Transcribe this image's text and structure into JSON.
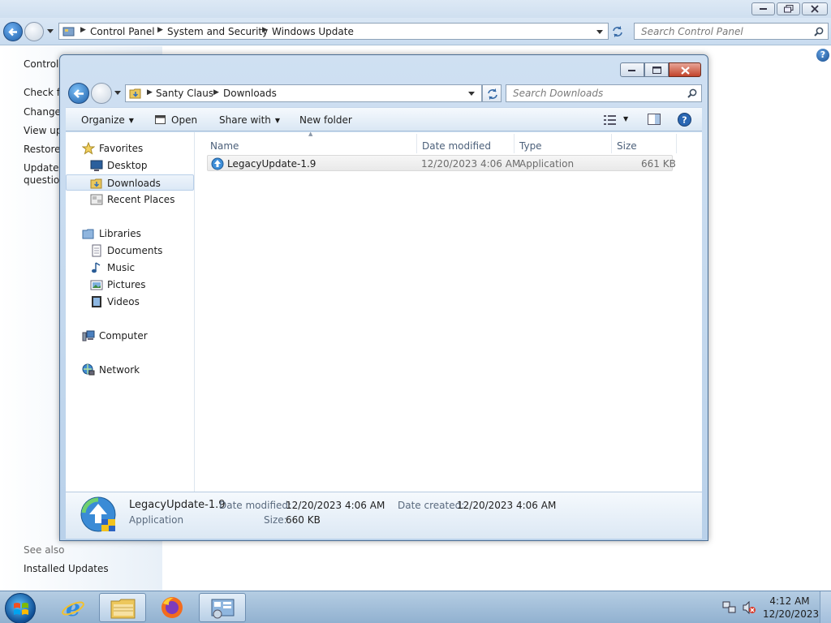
{
  "control_panel": {
    "breadcrumb": [
      "Control Panel",
      "System and Security",
      "Windows Update"
    ],
    "search_placeholder": "Search Control Panel",
    "left_links": [
      "Control",
      "Check fo",
      "Change",
      "View up",
      "Restore",
      "Updates",
      "question"
    ],
    "see_also_label": "See also",
    "installed_updates_label": "Installed Updates"
  },
  "explorer": {
    "breadcrumb": [
      "Santy Claus",
      "Downloads"
    ],
    "search_placeholder": "Search Downloads",
    "toolbar": {
      "organize_label": "Organize",
      "open_label": "Open",
      "share_label": "Share with",
      "new_folder_label": "New folder"
    },
    "nav": {
      "favorites": "Favorites",
      "desktop": "Desktop",
      "downloads": "Downloads",
      "recent_places": "Recent Places",
      "libraries": "Libraries",
      "documents": "Documents",
      "music": "Music",
      "pictures": "Pictures",
      "videos": "Videos",
      "computer": "Computer",
      "network": "Network"
    },
    "columns": {
      "name": "Name",
      "date_modified": "Date modified",
      "type": "Type",
      "size": "Size"
    },
    "files": [
      {
        "name": "LegacyUpdate-1.9",
        "date_modified": "12/20/2023 4:06 AM",
        "type": "Application",
        "size": "661 KB"
      }
    ],
    "details": {
      "name": "LegacyUpdate-1.9",
      "type": "Application",
      "date_modified_label": "Date modified:",
      "date_modified": "12/20/2023 4:06 AM",
      "size_label": "Size:",
      "size": "660 KB",
      "date_created_label": "Date created:",
      "date_created": "12/20/2023 4:06 AM"
    }
  },
  "taskbar": {
    "time": "4:12 AM",
    "date": "12/20/2023",
    "apps": [
      "internet-explorer",
      "windows-explorer",
      "firefox",
      "control-panel"
    ]
  },
  "colors": {
    "accent": "#1d5ea8",
    "window_frame": "#b9d1ea",
    "taskbar": "#a3c0dc"
  }
}
